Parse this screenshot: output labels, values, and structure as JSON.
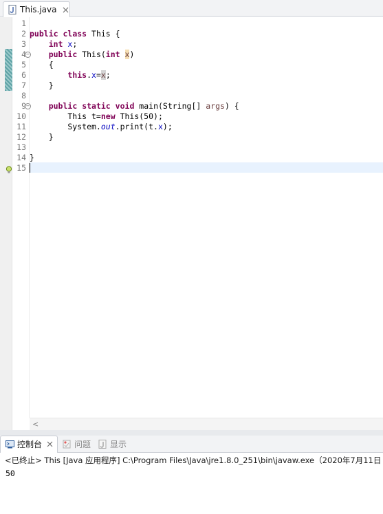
{
  "editor_tab": {
    "title": "This.java",
    "icon": "java-file-icon"
  },
  "code_lines": [
    {
      "n": "1",
      "text": ""
    },
    {
      "n": "2",
      "text": "public class This {"
    },
    {
      "n": "3",
      "text": "    int x;"
    },
    {
      "n": "4",
      "text": "    public This(int x)",
      "fold": "⊖"
    },
    {
      "n": "5",
      "text": "    {"
    },
    {
      "n": "6",
      "text": "        this.x=x;"
    },
    {
      "n": "7",
      "text": "    }"
    },
    {
      "n": "8",
      "text": ""
    },
    {
      "n": "9",
      "text": "    public static void main(String[] args) {",
      "fold": "⊖"
    },
    {
      "n": "10",
      "text": "        This t=new This(50);"
    },
    {
      "n": "11",
      "text": "        System.out.print(t.x);"
    },
    {
      "n": "12",
      "text": "    }"
    },
    {
      "n": "13",
      "text": ""
    },
    {
      "n": "14",
      "text": "}"
    },
    {
      "n": "15",
      "text": ""
    }
  ],
  "scroll_left_arrow": "<",
  "bottom_tabs": [
    {
      "label": "控制台",
      "icon": "console-icon",
      "active": true,
      "close": "✕"
    },
    {
      "label": "问题",
      "icon": "problems-icon",
      "active": false
    },
    {
      "label": "显示",
      "icon": "display-icon",
      "active": false
    }
  ],
  "console": {
    "status": "<已终止> This [Java 应用程序] C:\\Program Files\\Java\\jre1.8.0_251\\bin\\javaw.exe（2020年7月11日",
    "output": "50"
  },
  "colors": {
    "keyword": "#7f0055",
    "field": "#0000c0",
    "parameter": "#6a3e3e",
    "current_line": "#e8f2fe",
    "occurrence": "#f5deb3"
  }
}
